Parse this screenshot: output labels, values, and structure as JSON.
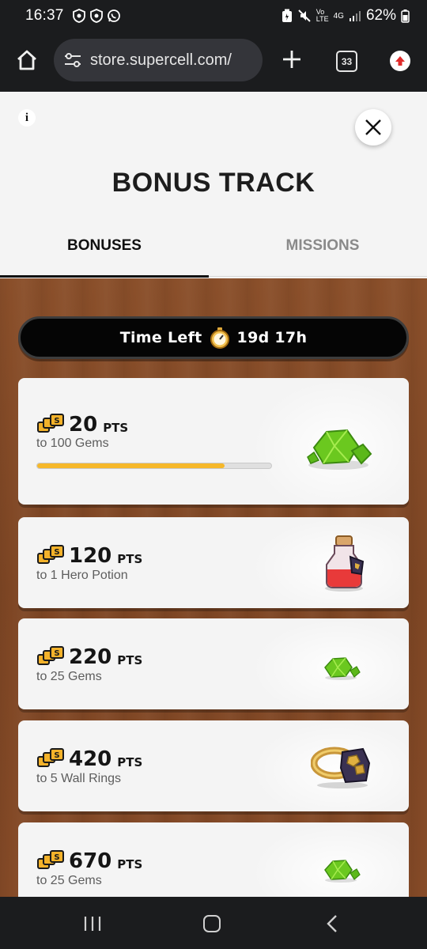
{
  "status_bar": {
    "time": "16:37",
    "battery": "62%",
    "network_label_top": "Vo",
    "network_label_bottom": "LTE",
    "network_gen": "4G"
  },
  "browser": {
    "url": "store.supercell.com/",
    "tab_count": "33"
  },
  "header": {
    "title": "BONUS TRACK",
    "tabs": [
      {
        "label": "BONUSES",
        "active": true
      },
      {
        "label": "MISSIONS",
        "active": false
      }
    ]
  },
  "timer": {
    "label": "Time Left",
    "value": "19d 17h"
  },
  "bonuses": [
    {
      "points": "20",
      "unit": "PTS",
      "reward": "to 100 Gems",
      "reward_icon": "gems-icon",
      "progress": 0.8
    },
    {
      "points": "120",
      "unit": "PTS",
      "reward": "to 1 Hero Potion",
      "reward_icon": "hero-potion-icon"
    },
    {
      "points": "220",
      "unit": "PTS",
      "reward": "to 25 Gems",
      "reward_icon": "gem-icon"
    },
    {
      "points": "420",
      "unit": "PTS",
      "reward": "to 5 Wall Rings",
      "reward_icon": "wall-ring-icon"
    },
    {
      "points": "670",
      "unit": "PTS",
      "reward": "to 25 Gems",
      "reward_icon": "gem-icon"
    }
  ],
  "colors": {
    "progress_fill": "#f6b82a",
    "wood": "#854a27",
    "timer_bg": "#050505"
  }
}
